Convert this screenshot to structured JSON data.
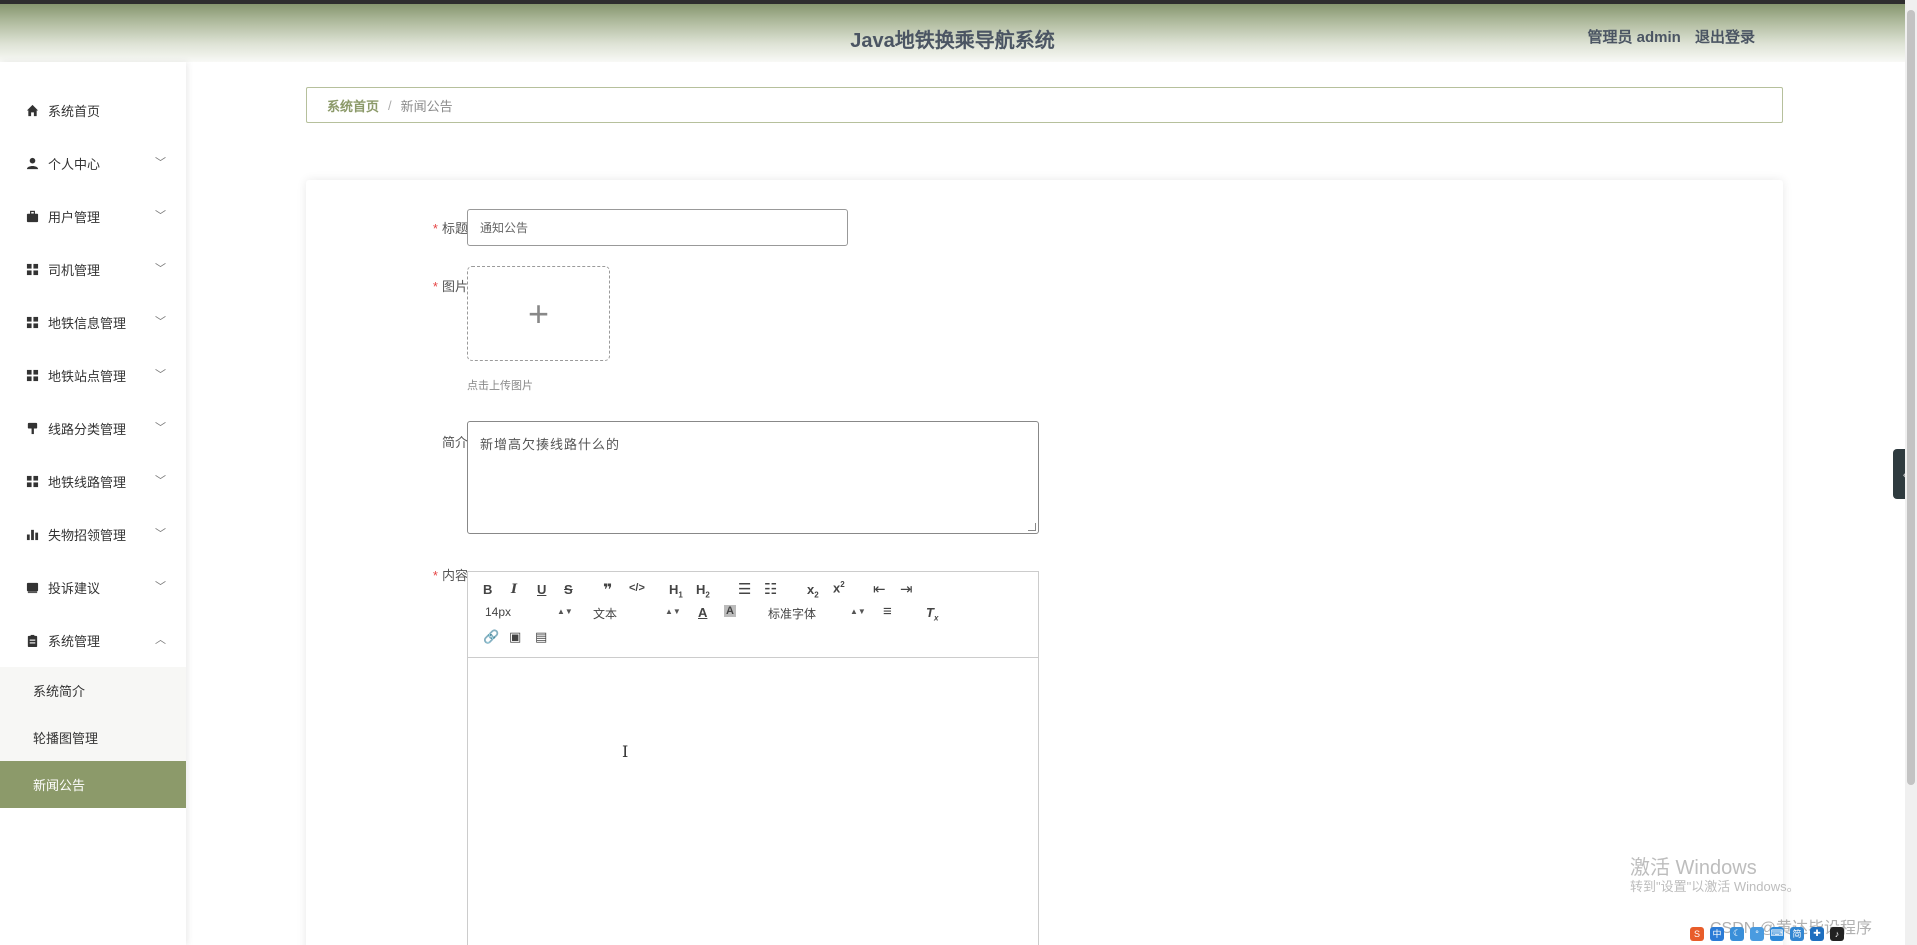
{
  "header": {
    "title": "Java地铁换乘导航系统",
    "user_label": "管理员 admin",
    "logout": "退出登录"
  },
  "sidebar": {
    "items": [
      {
        "label": "系统首页",
        "icon": "home-icon"
      },
      {
        "label": "个人中心",
        "icon": "user-icon"
      },
      {
        "label": "用户管理",
        "icon": "briefcase-icon"
      },
      {
        "label": "司机管理",
        "icon": "grid-icon"
      },
      {
        "label": "地铁信息管理",
        "icon": "grid-icon"
      },
      {
        "label": "地铁站点管理",
        "icon": "grid-icon"
      },
      {
        "label": "线路分类管理",
        "icon": "brush-icon"
      },
      {
        "label": "地铁线路管理",
        "icon": "grid-icon"
      },
      {
        "label": "失物招领管理",
        "icon": "bar-chart-icon"
      },
      {
        "label": "投诉建议",
        "icon": "inbox-icon"
      },
      {
        "label": "系统管理",
        "icon": "clipboard-icon"
      }
    ],
    "sub_items": [
      {
        "label": "系统简介"
      },
      {
        "label": "轮播图管理"
      },
      {
        "label": "新闻公告"
      }
    ]
  },
  "breadcrumb": {
    "home": "系统首页",
    "separator": "/",
    "current": "新闻公告"
  },
  "form": {
    "title": {
      "label": "标题",
      "value": "通知公告"
    },
    "image": {
      "label": "图片",
      "plus": "+",
      "hint": "点击上传图片"
    },
    "intro": {
      "label": "简介",
      "value": "新增高欠揍线路什么的"
    },
    "content": {
      "label": "内容",
      "font_size": "14px",
      "format": "文本",
      "font_family": "标准字体"
    }
  },
  "watermark": {
    "line1": "激活 Windows",
    "line2": "转到\"设置\"以激活 Windows。"
  },
  "csdn": "CSDN @黄达毕设程序",
  "colors": {
    "accent": "#8c9a6a",
    "required": "#e64545"
  }
}
